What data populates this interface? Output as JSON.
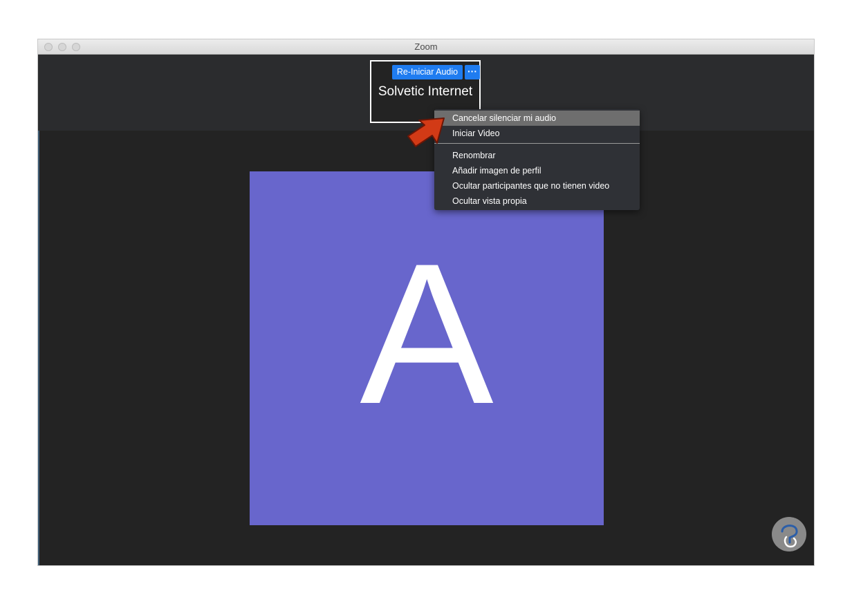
{
  "window": {
    "title": "Zoom"
  },
  "thumbnail": {
    "reaudio_label": "Re-Iniciar Audio",
    "more_label": "···",
    "name": "Solvetic Internet"
  },
  "avatar": {
    "letter": "A",
    "color": "#6866cc"
  },
  "context_menu": {
    "items": [
      {
        "label": "Cancelar silenciar mi audio",
        "highlighted": true
      },
      {
        "label": "Iniciar Video"
      },
      {
        "label": "Renombrar"
      },
      {
        "label": "Añadir imagen de perfil"
      },
      {
        "label": "Ocultar participantes que no tienen video"
      },
      {
        "label": "Ocultar vista propia"
      }
    ]
  },
  "colors": {
    "accent": "#1f7cf0",
    "arrow": "#d23a16",
    "background": "#232323"
  },
  "icons": {
    "arrow": "red-pointer-arrow-icon",
    "logo": "solvetic-logo-icon"
  }
}
